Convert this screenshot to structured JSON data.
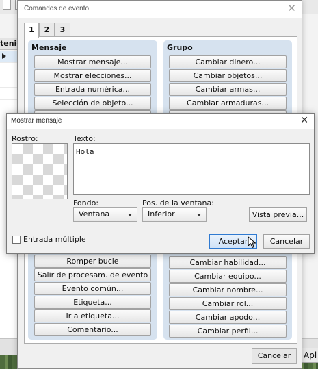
{
  "background": {
    "column_header": "tenid",
    "apply_label": "Apl"
  },
  "command_window": {
    "title": "Comandos de evento",
    "tabs": [
      "1",
      "2",
      "3"
    ],
    "mensaje_group": {
      "title": "Mensaje",
      "buttons_top": [
        "Mostrar mensaje...",
        "Mostrar elecciones...",
        "Entrada numérica...",
        "Selección de objeto..."
      ],
      "buttons_bottom": [
        "Romper bucle",
        "Salir de procesam. de evento",
        "Evento común...",
        "Etiqueta...",
        "Ir a etiqueta...",
        "Comentario..."
      ]
    },
    "grupo_group": {
      "title": "Grupo",
      "buttons_top": [
        "Cambiar dinero...",
        "Cambiar objetos...",
        "Cambiar armas...",
        "Cambiar armaduras..."
      ],
      "buttons_bottom": [
        "Cambiar habilidad...",
        "Cambiar equipo...",
        "Cambiar nombre...",
        "Cambiar rol...",
        "Cambiar apodo...",
        "Cambiar perfil..."
      ]
    },
    "cancel_label": "Cancelar"
  },
  "message_dialog": {
    "title": "Mostrar mensaje",
    "face_label": "Rostro:",
    "text_label": "Texto:",
    "text_value": "Hola",
    "background_label": "Fondo:",
    "background_value": "Ventana",
    "position_label": "Pos. de la ventana:",
    "position_value": "Inferior",
    "preview_label": "Vista previa...",
    "batch_entry_label": "Entrada múltiple",
    "batch_entry_checked": false,
    "accept_label": "Aceptar",
    "cancel_label": "Cancelar"
  },
  "colors": {
    "group_panel": "#d6e2ef",
    "primary_button_border": "#2f7ad1"
  }
}
